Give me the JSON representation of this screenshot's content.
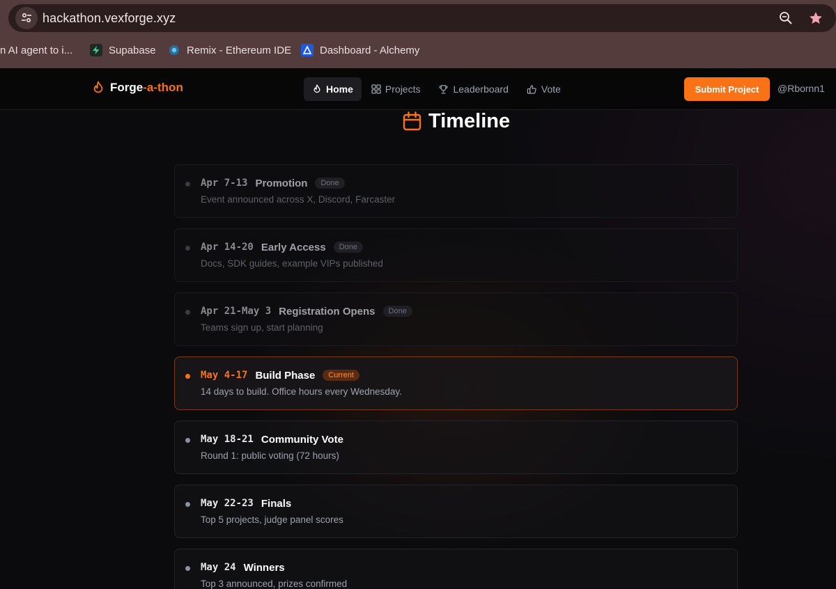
{
  "browser": {
    "url": "hackathon.vexforge.xyz",
    "bookmarks": [
      {
        "label": "n AI agent to i...",
        "icon": "none"
      },
      {
        "label": "Supabase",
        "icon": "supabase-icon"
      },
      {
        "label": "Remix - Ethereum IDE",
        "icon": "remix-icon"
      },
      {
        "label": "Dashboard - Alchemy",
        "icon": "alchemy-icon"
      }
    ]
  },
  "nav": {
    "brand_main": "Forge",
    "brand_accent": "-a-thon",
    "items": [
      {
        "label": "Home",
        "icon": "flame-icon",
        "active": true
      },
      {
        "label": "Projects",
        "icon": "grid-icon",
        "active": false
      },
      {
        "label": "Leaderboard",
        "icon": "trophy-icon",
        "active": false
      },
      {
        "label": "Vote",
        "icon": "thumbs-up-icon",
        "active": false
      }
    ],
    "submit_label": "Submit Project",
    "user": "@Rbornn1"
  },
  "colors": {
    "accent": "#f97316",
    "background": "#0b0b0e"
  },
  "timeline": {
    "title": "Timeline",
    "items": [
      {
        "date": "Apr 7-13",
        "title": "Promotion",
        "badge": "Done",
        "desc": "Event announced across X, Discord, Farcaster",
        "status": "done"
      },
      {
        "date": "Apr 14-20",
        "title": "Early Access",
        "badge": "Done",
        "desc": "Docs, SDK guides, example VIPs published",
        "status": "done"
      },
      {
        "date": "Apr 21-May 3",
        "title": "Registration Opens",
        "badge": "Done",
        "desc": "Teams sign up, start planning",
        "status": "done"
      },
      {
        "date": "May 4-17",
        "title": "Build Phase",
        "badge": "Current",
        "desc": "14 days to build. Office hours every Wednesday.",
        "status": "current"
      },
      {
        "date": "May 18-21",
        "title": "Community Vote",
        "badge": "",
        "desc": "Round 1: public voting (72 hours)",
        "status": "upcoming"
      },
      {
        "date": "May 22-23",
        "title": "Finals",
        "badge": "",
        "desc": "Top 5 projects, judge panel scores",
        "status": "upcoming"
      },
      {
        "date": "May 24",
        "title": "Winners",
        "badge": "",
        "desc": "Top 3 announced, prizes confirmed",
        "status": "upcoming"
      }
    ]
  }
}
